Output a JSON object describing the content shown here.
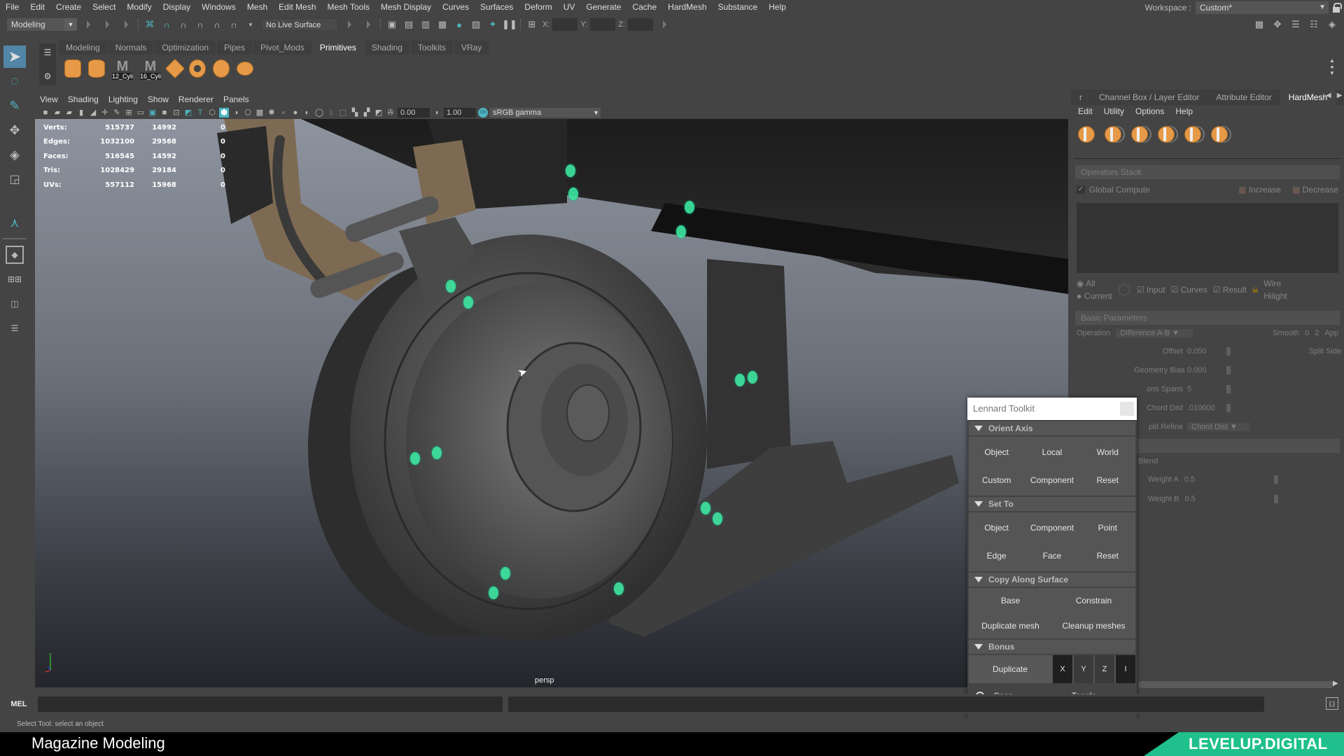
{
  "menubar": {
    "items": [
      "File",
      "Edit",
      "Create",
      "Select",
      "Modify",
      "Display",
      "Windows",
      "Mesh",
      "Edit Mesh",
      "Mesh Tools",
      "Mesh Display",
      "Curves",
      "Surfaces",
      "Deform",
      "UV",
      "Generate",
      "Cache",
      "HardMesh",
      "Substance",
      "Help"
    ],
    "workspace_label": "Workspace :",
    "workspace_value": "Custom*"
  },
  "statusline": {
    "mode": "Modeling",
    "live_surface": "No Live Surface",
    "x_label": "X:",
    "y_label": "Y:",
    "z_label": "Z:"
  },
  "shelf": {
    "tabs": [
      "Modeling",
      "Normals",
      "Optimization",
      "Pipes",
      "Pivot_Mods",
      "Primitives",
      "Shading",
      "Toolkits",
      "VRay"
    ],
    "active_tab": "Primitives",
    "icons": [
      {
        "name": "cube-primitive-icon",
        "label": ""
      },
      {
        "name": "cylinder-primitive-icon",
        "label": ""
      },
      {
        "name": "cylinder-12-icon",
        "label": "12_Cyli"
      },
      {
        "name": "cylinder-16-icon",
        "label": "16_Cyli"
      },
      {
        "name": "diamond-primitive-icon",
        "label": ""
      },
      {
        "name": "torus-primitive-icon",
        "label": ""
      },
      {
        "name": "sphere-primitive-icon",
        "label": ""
      },
      {
        "name": "stack-primitive-icon",
        "label": ""
      }
    ]
  },
  "viewport": {
    "menu": [
      "View",
      "Shading",
      "Lighting",
      "Show",
      "Renderer",
      "Panels"
    ],
    "exposure": "0.00",
    "gamma": "1.00",
    "color_mgmt_toggle": "ON",
    "color_space": "sRGB gamma",
    "camera_label": "persp",
    "axis": {
      "x": "x",
      "y": "y",
      "z": "z"
    },
    "hud": [
      {
        "label": "Verts:",
        "total": "515737",
        "selected": "14992",
        "extra": "0"
      },
      {
        "label": "Edges:",
        "total": "1032100",
        "selected": "29568",
        "extra": "0"
      },
      {
        "label": "Faces:",
        "total": "516545",
        "selected": "14592",
        "extra": "0"
      },
      {
        "label": "Tris:",
        "total": "1028429",
        "selected": "29184",
        "extra": "0"
      },
      {
        "label": "UVs:",
        "total": "557112",
        "selected": "15968",
        "extra": "0"
      }
    ]
  },
  "right_panel": {
    "tabs": [
      "Channel Box / Layer Editor",
      "Attribute Editor",
      "HardMesh"
    ],
    "active_tab": "HardMesh",
    "menu": [
      "Edit",
      "Utility",
      "Options",
      "Help"
    ],
    "operators_stack": {
      "title": "Operators Stack",
      "global_compute": "Global Compute",
      "increase": "Increase",
      "decrease": "Decrease",
      "radio_all": "All",
      "radio_current": "Current",
      "chk_input": "Input",
      "chk_curves": "Curves",
      "chk_result": "Result",
      "wire": "Wire",
      "hilight": "Hilight"
    },
    "basic_parameters": {
      "title": "Basic Parameters",
      "operation_label": "Operation",
      "operation_value": "Difference A-B",
      "smooth_label": "Smooth",
      "smooth_min": "0",
      "smooth_value": "2",
      "apply": "App",
      "offset_label": "Offset",
      "offset_value": "0.050",
      "split_side": "Split Side",
      "geometry_bias_label": "Geometry Bias",
      "geometry_bias_value": "0.000",
      "sections_spans_label": "ons Spans",
      "sections_spans_value": "5",
      "chord_dist_label": "Chord Dist",
      "chord_dist_value": ".010000",
      "split_refine_label": "plit Refine",
      "split_refine_value": "Chord Dist",
      "blend_label": "Blend",
      "weight_a_label": "Weight A",
      "weight_a_value": "0.5",
      "weight_b_label": "Weight B",
      "weight_b_value": "0.5"
    }
  },
  "toolkit": {
    "title": "Lennard Toolkit",
    "orient_axis": {
      "title": "Orient Axis",
      "buttons": [
        "Object",
        "Local",
        "World",
        "Custom",
        "Component",
        "Reset"
      ]
    },
    "set_to": {
      "title": "Set To",
      "buttons": [
        "Object",
        "Component",
        "Point",
        "Edge",
        "Face",
        "Reset"
      ]
    },
    "copy_along_surface": {
      "title": "Copy Along Surface",
      "buttons": [
        "Base",
        "Constrain",
        "Duplicate mesh",
        "Cleanup meshes"
      ]
    },
    "bonus": {
      "title": "Bonus",
      "duplicate": "Duplicate",
      "axes": [
        "X",
        "Y",
        "Z",
        "I"
      ]
    },
    "snap_together": "Snap Together",
    "toggle_wireframe": "Toggle Wireframe"
  },
  "bottom": {
    "mel_label": "MEL",
    "help_text": "Select Tool: select an object"
  },
  "footer": {
    "title": "Magazine Modeling",
    "brand": "LEVELUP.DIGITAL",
    "brand_color": "#1fc08c"
  },
  "colors": {
    "accent_teal": "#4fb3bf",
    "selection_green": "#3de7a0",
    "primitive_orange": "#e69a47",
    "active_tool_blue": "#5285a6"
  }
}
